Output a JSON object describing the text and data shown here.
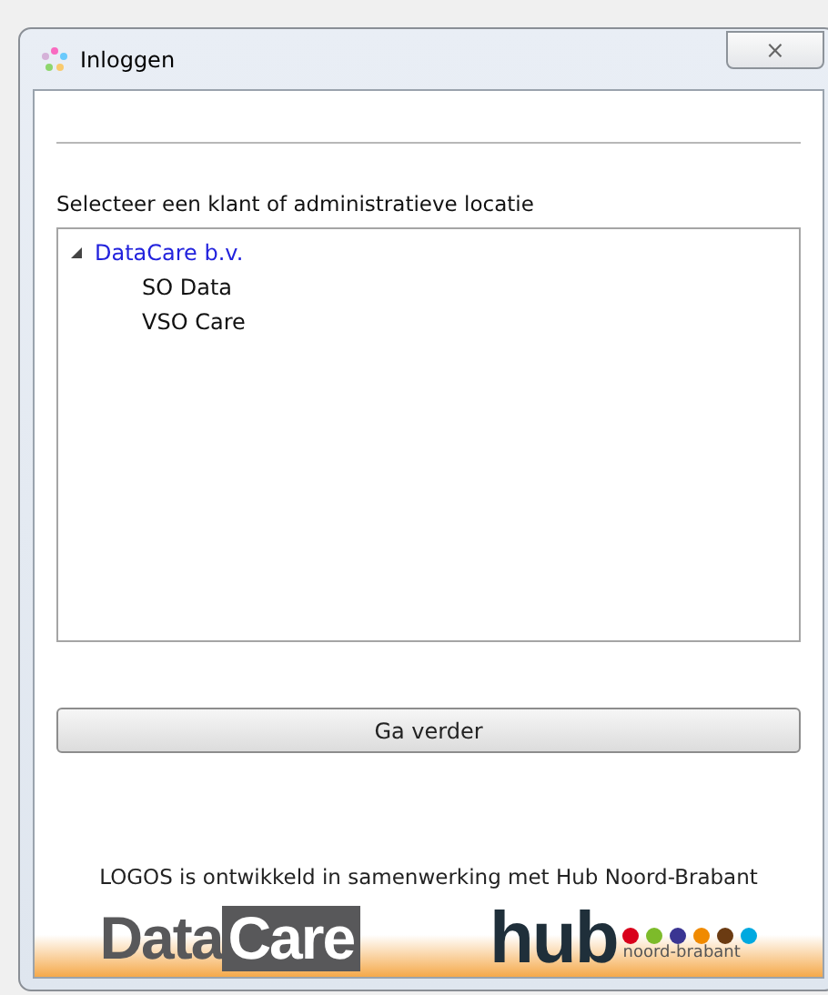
{
  "window": {
    "title": "Inloggen",
    "close": "⨯"
  },
  "prompt": "Selecteer een klant of administratieve locatie",
  "tree": [
    {
      "label": "DataCare b.v.",
      "selected": true,
      "expanded": true,
      "children": [
        {
          "label": "SO Data",
          "selected": false
        },
        {
          "label": "VSO Care",
          "selected": false
        }
      ]
    }
  ],
  "button": "Ga verder",
  "footer": "LOGOS is ontwikkeld in samenwerking met Hub Noord-Brabant",
  "logos": {
    "datacare": [
      "Data",
      "Care"
    ],
    "hub": "hub",
    "hub_sub": "noord-brabant"
  }
}
